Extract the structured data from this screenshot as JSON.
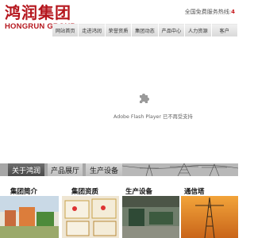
{
  "brand": {
    "name_cn": "鸿润集团",
    "name_en": "HONGRUN GROUP",
    "color": "#b5161d"
  },
  "hotline": {
    "label": "全国免费服务热线:",
    "number_visible": "4"
  },
  "nav": {
    "items": [
      {
        "label": "网站首页"
      },
      {
        "label": "走进鸿润"
      },
      {
        "label": "荣誉资质"
      },
      {
        "label": "集团动态"
      },
      {
        "label": "产品中心"
      },
      {
        "label": "人力资源"
      },
      {
        "label": "客户"
      }
    ]
  },
  "flash": {
    "message": "Adobe Flash Player 已不再受支持",
    "icon": "puzzle-plugin-icon"
  },
  "sub_tabs": [
    {
      "label": "关于鸿润",
      "active": true
    },
    {
      "label": "产品展厅",
      "active": false
    },
    {
      "label": "生产设备",
      "active": false
    }
  ],
  "sections": [
    {
      "title": "集团简介"
    },
    {
      "title": "集团资质"
    },
    {
      "title": "生产设备"
    },
    {
      "title": "通信塔"
    }
  ],
  "colors": {
    "nav_bg": "#e2e2e2",
    "active_tab": "#555555",
    "accent_red": "#c81d20"
  }
}
